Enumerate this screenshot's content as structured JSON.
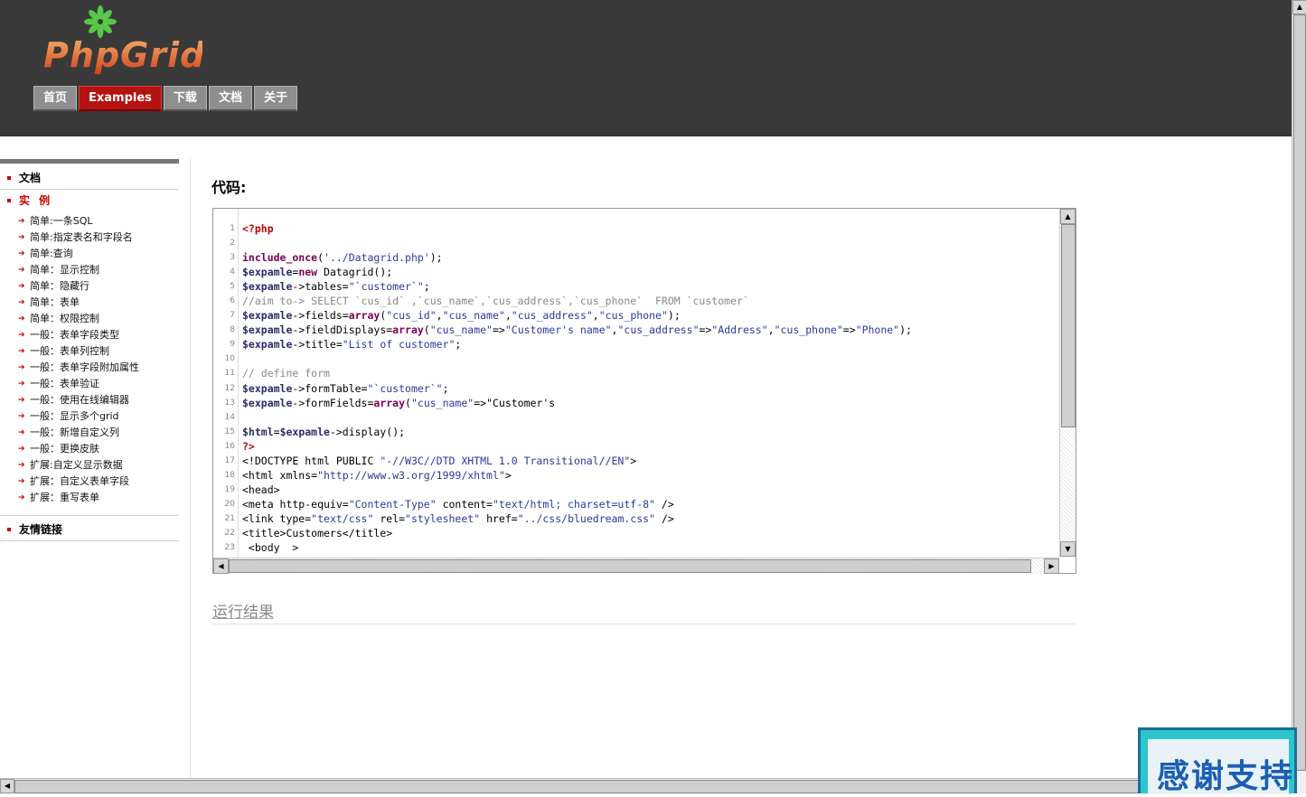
{
  "logo": {
    "text": "PhpGrid"
  },
  "nav": {
    "tabs": [
      {
        "label": "首页",
        "active": false
      },
      {
        "label": "Examples",
        "active": true
      },
      {
        "label": "下载",
        "active": false
      },
      {
        "label": "文档",
        "active": false
      },
      {
        "label": "关于",
        "active": false
      }
    ]
  },
  "sidebar": {
    "docs_label": "文档",
    "examples_label": "实 例",
    "items": [
      "简单:一条SQL",
      "简单:指定表名和字段名",
      "简单:查询",
      "简单：显示控制",
      "简单：隐藏行",
      "简单：表单",
      "简单：权限控制",
      "一般：表单字段类型",
      "一般：表单列控制",
      "一般：表单字段附加属性",
      "一般：表单验证",
      "一般：使用在线编辑器",
      "一般：显示多个grid",
      "一般：新增自定义列",
      "一般：更换皮肤",
      "扩展:自定义显示数据",
      "扩展：自定义表单字段",
      "扩展：重写表单"
    ],
    "links_label": "友情链接"
  },
  "main": {
    "code_title": "代码:",
    "result_heading": "运行结果",
    "code_lines": [
      "<?php",
      "",
      "include_once('../Datagrid.php');",
      "$expamle=new Datagrid();",
      "$expamle->tables=\"`customer`\";",
      "//aim to-> SELECT `cus_id` ,`cus_name`,`cus_address`,`cus_phone`  FROM `customer`",
      "$expamle->fields=array(\"cus_id\",\"cus_name\",\"cus_address\",\"cus_phone\");",
      "$expamle->fieldDisplays=array(\"cus_name\"=>\"Customer's name\",\"cus_address\"=>\"Address\",\"cus_phone\"=>\"Phone\");",
      "$expamle->title=\"List of customer\";",
      "",
      "// define form",
      "$expamle->formTable=\"`customer`\";",
      "$expamle->formFields=array(\"cus_name\"=>\"Customer's",
      "",
      "$html=$expamle->display();",
      "?>",
      "<!DOCTYPE html PUBLIC \"-//W3C//DTD XHTML 1.0 Transitional//EN\">",
      "<html xmlns=\"http://www.w3.org/1999/xhtml\">",
      "<head>",
      "<meta http-equiv=\"Content-Type\" content=\"text/html; charset=utf-8\" />",
      "<link type=\"text/css\" rel=\"stylesheet\" href=\"../css/bluedream.css\" />",
      "<title>Customers</title>",
      " <body  >"
    ]
  },
  "badge": {
    "text": "感谢支持"
  },
  "colors": {
    "header_bg": "#393939",
    "active_tab": "#b51212",
    "badge": "#2dc4cb"
  }
}
